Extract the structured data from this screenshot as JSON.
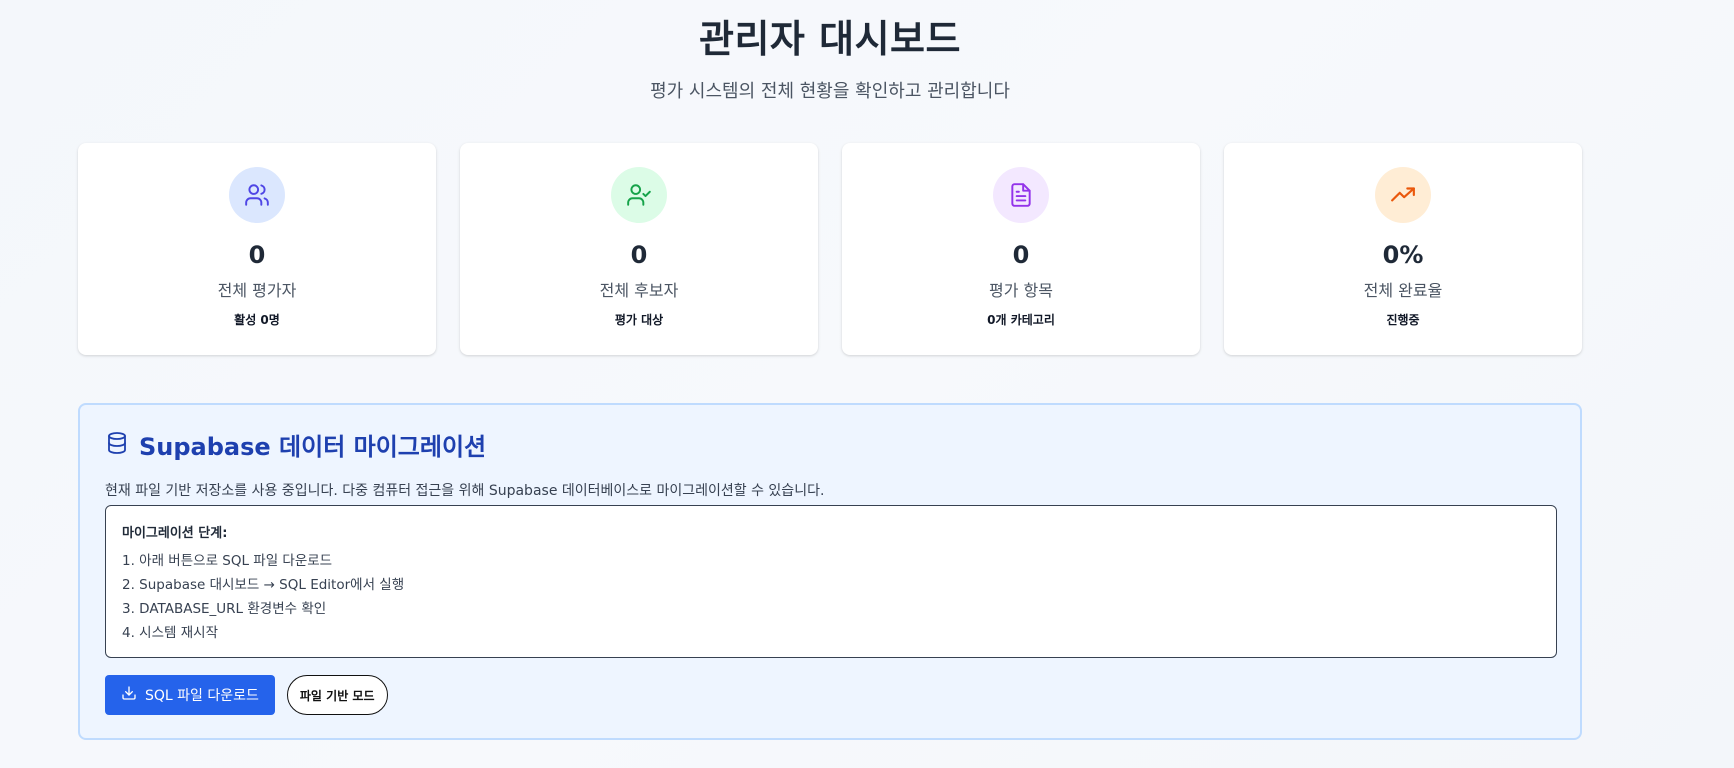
{
  "header": {
    "title": "관리자 대시보드",
    "subtitle": "평가 시스템의 전체 현황을 확인하고 관리합니다"
  },
  "stats": [
    {
      "icon": "users-icon",
      "color": "#4f46e5",
      "bg": "#dbe7fe",
      "value": "0",
      "label": "전체 평가자",
      "sub": "활성 0명"
    },
    {
      "icon": "user-check-icon",
      "color": "#16a34a",
      "bg": "#dcfce7",
      "value": "0",
      "label": "전체 후보자",
      "sub": "평가 대상"
    },
    {
      "icon": "document-icon",
      "color": "#9333ea",
      "bg": "#f3e8ff",
      "value": "0",
      "label": "평가 항목",
      "sub": "0개 카테고리"
    },
    {
      "icon": "trending-up-icon",
      "color": "#ea580c",
      "bg": "#ffedd5",
      "value": "0%",
      "label": "전체 완료율",
      "sub": "진행중"
    }
  ],
  "migration": {
    "icon": "database-icon",
    "title": "Supabase 데이터 마이그레이션",
    "description": "현재 파일 기반 저장소를 사용 중입니다. 다중 컴퓨터 접근을 위해 Supabase 데이터베이스로 마이그레이션할 수 있습니다.",
    "steps_title": "마이그레이션 단계:",
    "steps": [
      "1. 아래 버튼으로 SQL 파일 다운로드",
      "2. Supabase 대시보드 → SQL Editor에서 실행",
      "3. DATABASE_URL 환경변수 확인",
      "4. 시스템 재시작"
    ],
    "download_label": "SQL 파일 다운로드",
    "file_mode_label": "파일 기반 모드"
  },
  "colors": {
    "primary": "#2563eb",
    "migration_title": "#1e40af",
    "migration_bg": "#eef5ff",
    "migration_border": "#bfdbfe"
  }
}
